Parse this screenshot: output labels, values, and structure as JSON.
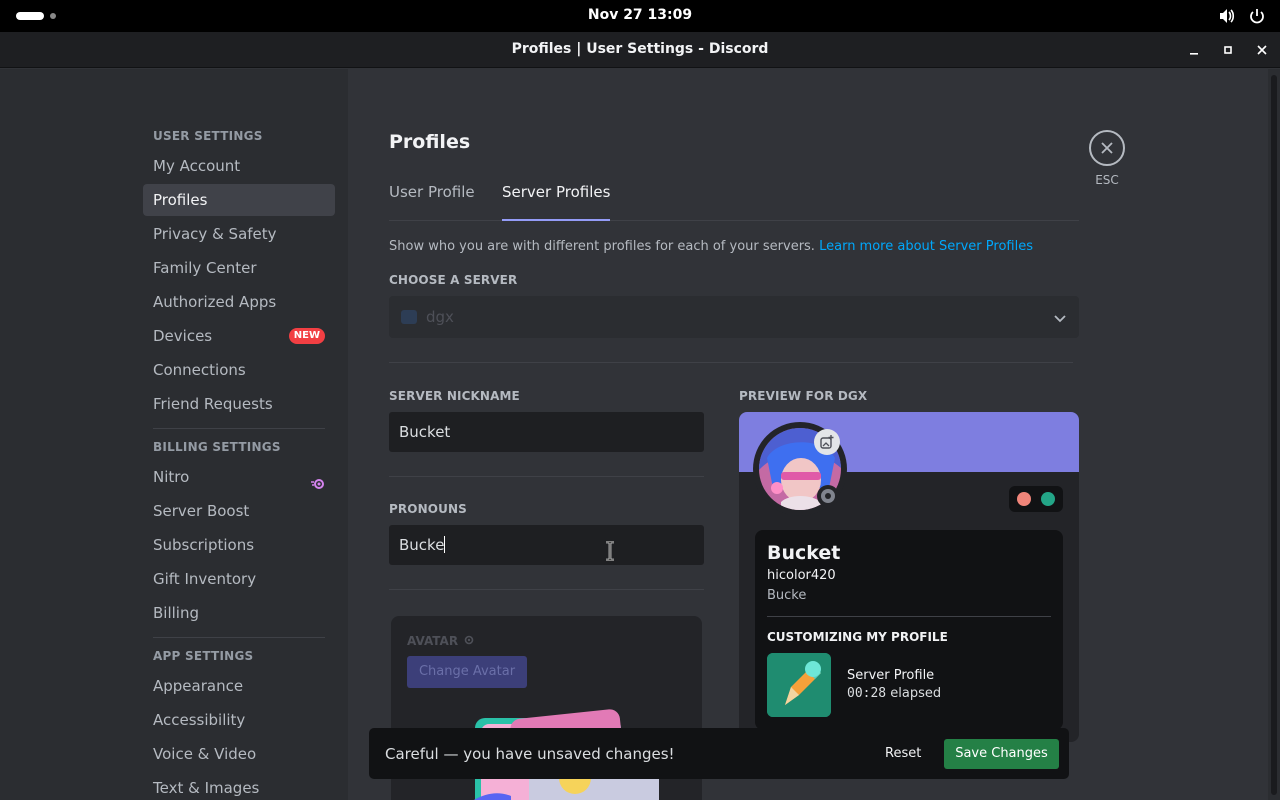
{
  "system": {
    "clock": "Nov 27  13:09"
  },
  "window": {
    "title": "Profiles | User Settings - Discord"
  },
  "sidebar": {
    "user_settings_header": "USER SETTINGS",
    "user_items": [
      "My Account",
      "Profiles",
      "Privacy & Safety",
      "Family Center",
      "Authorized Apps",
      "Devices",
      "Connections",
      "Friend Requests"
    ],
    "new_badge": "NEW",
    "billing_header": "BILLING SETTINGS",
    "billing_items": [
      "Nitro",
      "Server Boost",
      "Subscriptions",
      "Gift Inventory",
      "Billing"
    ],
    "app_header": "APP SETTINGS",
    "app_items": [
      "Appearance",
      "Accessibility",
      "Voice & Video",
      "Text & Images"
    ]
  },
  "main": {
    "title": "Profiles",
    "tabs": [
      "User Profile",
      "Server Profiles"
    ],
    "description": "Show who you are with different profiles for each of your servers.",
    "learn_more": "Learn more about Server Profiles",
    "choose_server_label": "CHOOSE A SERVER",
    "selected_server": "dgx",
    "nickname_label": "SERVER NICKNAME",
    "nickname_value": "Bucket",
    "pronouns_label": "PRONOUNS",
    "pronouns_value": "Bucke",
    "avatar_label": "AVATAR",
    "change_avatar": "Change Avatar"
  },
  "preview": {
    "label": "PREVIEW FOR DGX",
    "display_name": "Bucket",
    "username": "hicolor420",
    "pronouns": "Bucke",
    "customizing_header": "CUSTOMIZING MY PROFILE",
    "activity_title": "Server Profile",
    "elapsed_time": "00:28",
    "elapsed_suffix": "elapsed"
  },
  "close": {
    "esc_label": "ESC"
  },
  "notice": {
    "message": "Careful — you have unsaved changes!",
    "reset": "Reset",
    "save": "Save Changes"
  },
  "colors": {
    "accent": "#949cf7",
    "banner": "#7e7ee0",
    "save": "#248046",
    "new_badge": "#f23f43",
    "link": "#00a8fc"
  }
}
